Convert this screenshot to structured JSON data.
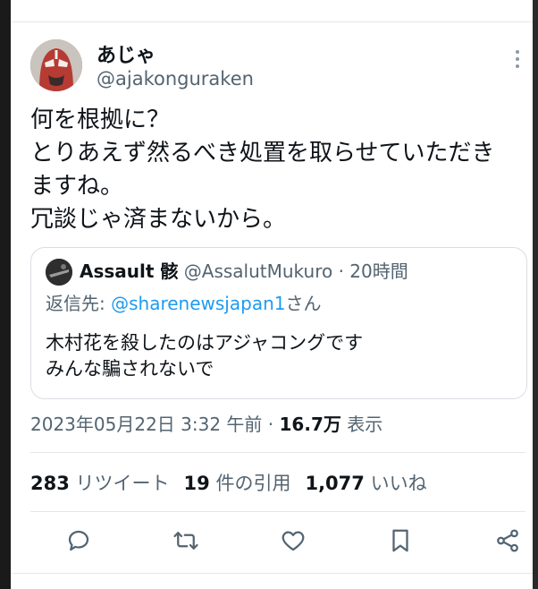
{
  "tweet": {
    "display_name": "あじゃ",
    "handle": "@ajakonguraken",
    "text_lines": [
      "何を根拠に？",
      "とりあえず然るべき処置を取らせていただき",
      "ますね。",
      "冗談じゃ済まないから。"
    ],
    "timestamp": "2023年05月22日 3:32 午前",
    "separator": " · ",
    "views_count": "16.7万",
    "views_label": " 表示"
  },
  "quote": {
    "display_name": "Assault 骸",
    "handle": "@AssalutMukuro",
    "time": " · 20時間",
    "reply_prefix": "返信先: ",
    "reply_mention": "@sharenewsjapan1",
    "reply_suffix": "さん",
    "text_lines": [
      "木村花を殺したのはアジャコングです",
      "みんな騙されないで"
    ]
  },
  "stats": {
    "retweets_count": "283",
    "retweets_label": " リツイート",
    "quotes_count": "19",
    "quotes_label": " 件の引用",
    "likes_count": "1,077",
    "likes_label": " いいね"
  },
  "actions": [
    "reply-icon",
    "retweet-icon",
    "like-icon",
    "bookmark-icon",
    "share-icon"
  ],
  "colors": {
    "text": "#0f1419",
    "secondary": "#536471",
    "link": "#1d9bf0",
    "border": "#d8dee3"
  }
}
